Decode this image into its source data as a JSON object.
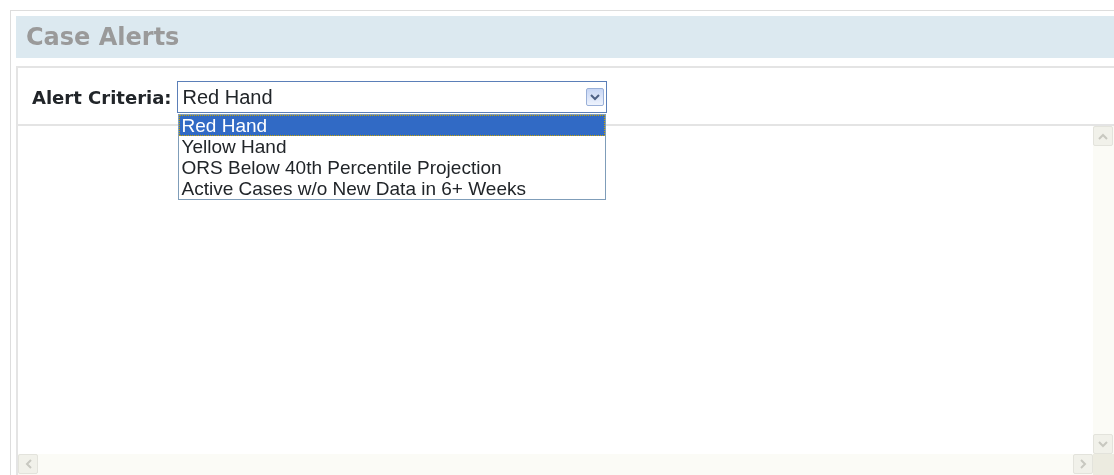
{
  "header": {
    "title": "Case Alerts"
  },
  "criteria": {
    "label": "Alert Criteria:",
    "value": "Red Hand",
    "expanded": true,
    "options": [
      {
        "label": "Red Hand",
        "selected": true
      },
      {
        "label": "Yellow Hand",
        "selected": false
      },
      {
        "label": "ORS Below 40th Percentile Projection",
        "selected": false
      },
      {
        "label": "Active Cases w/o New Data in 6+ Weeks",
        "selected": false
      }
    ]
  }
}
